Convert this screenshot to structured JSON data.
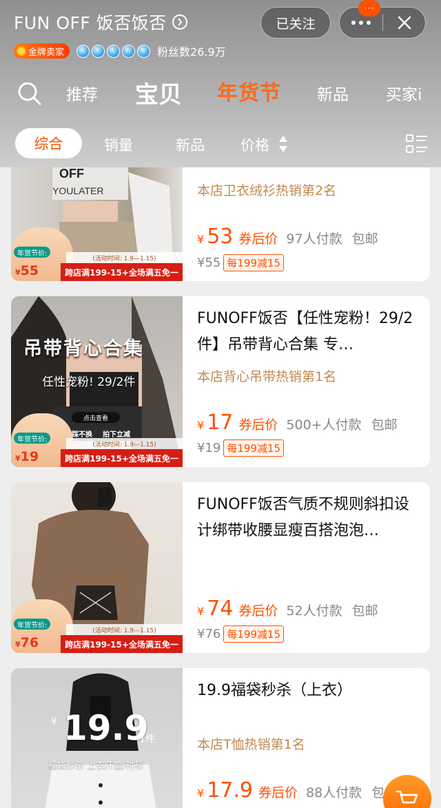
{
  "header": {
    "shop_name": "FUN OFF 饭否饭否",
    "follow_label": "已关注",
    "more_badge": "···",
    "seller_badge": "金牌卖家",
    "fans": "粉丝数26.9万"
  },
  "nav": {
    "items": [
      "推荐",
      "宝贝",
      "年货节",
      "新品",
      "买家i"
    ]
  },
  "filter": {
    "items": [
      "综合",
      "销量",
      "新品",
      "价格"
    ]
  },
  "promo": {
    "label": "年货节价:",
    "time": "(活动时间: 1.9—1.15)",
    "bar": "跨店满199-15+全场满五免一",
    "yen": "¥"
  },
  "products": [
    {
      "title": "",
      "rank": "本店卫衣绒衫热销第2名",
      "yen": "¥",
      "price": "53",
      "price_tag": "券后价",
      "sold": "97人付款",
      "shipping": "包邮",
      "orig_price": "¥55",
      "coupon": "每199减15",
      "promo_price": "55"
    },
    {
      "title": "FUNOFF饭否【任性宠粉！29/2件】吊带背心合集 专…",
      "rank": "本店背心吊带热销第1名",
      "yen": "¥",
      "price": "17",
      "price_tag": "券后价",
      "sold": "500+人付款",
      "shipping": "包邮",
      "orig_price": "¥19",
      "coupon": "每199减15",
      "promo_price": "19",
      "overlay_title": "吊带背心合集",
      "overlay_sub": "任性宠粉! 29/2件",
      "overlay_btn": "点击查看",
      "overlay_tags": [
        "不踩不换",
        "拍下立减"
      ]
    },
    {
      "title": "FUNOFF饭否气质不规则斜扣设计绑带收腰显瘦百搭泡泡…",
      "rank": "",
      "yen": "¥",
      "price": "74",
      "price_tag": "券后价",
      "sold": "52人付款",
      "shipping": "包邮",
      "orig_price": "¥76",
      "coupon": "每199减15",
      "promo_price": "76"
    },
    {
      "title": "19.9福袋秒杀（上衣）",
      "rank": "本店T恤热销第1名",
      "yen": "¥",
      "price": "17.9",
      "price_tag": "券后价",
      "sold": "88人付款",
      "shipping": "包",
      "overlay_price": "19.9",
      "overlay_unit": "1件",
      "overlay_yen": "¥",
      "overlay_desc": "福袋秒杀 上衣/T恤/衬衫"
    }
  ],
  "colors": {
    "accent": "#ff5000",
    "festival": "#ff6a1a",
    "rank": "#c08a52"
  }
}
